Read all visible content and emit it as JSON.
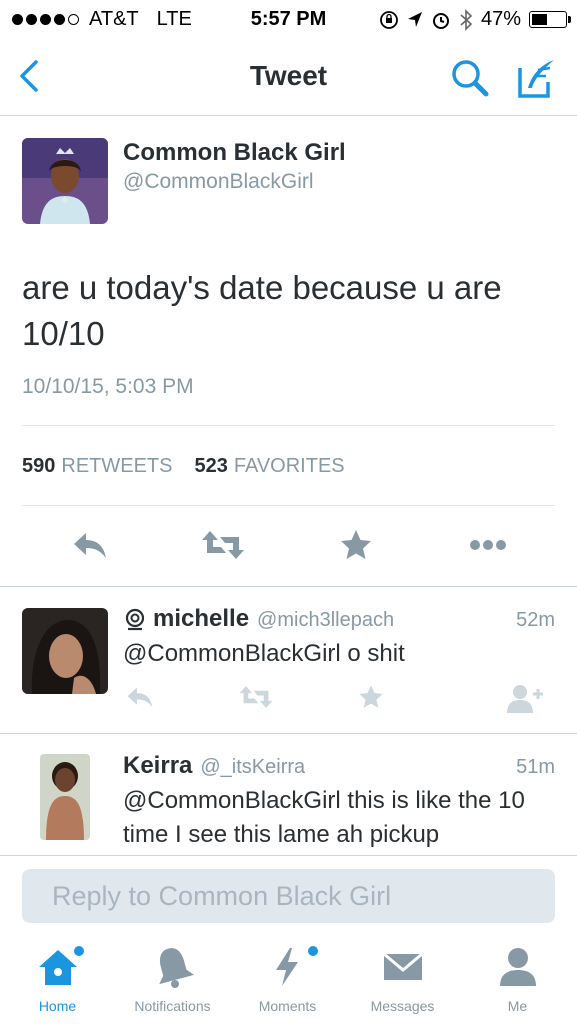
{
  "status_bar": {
    "carrier": "AT&T",
    "network": "LTE",
    "time": "5:57 PM",
    "battery": "47%",
    "battery_level": 0.47
  },
  "nav": {
    "title": "Tweet",
    "back_icon": "chevron-left-icon",
    "search_icon": "search-icon",
    "compose_icon": "compose-icon"
  },
  "tweet": {
    "author_name": "Common Black Girl",
    "author_handle": "@CommonBlackGirl",
    "text": "are u today's date because u are 10/10",
    "timestamp": "10/10/15, 5:03 PM",
    "retweets_count": "590",
    "retweets_label": "RETWEETS",
    "favorites_count": "523",
    "favorites_label": "FAVORITES"
  },
  "replies": [
    {
      "name": "michelle",
      "handle": "@mich3llepach",
      "ago": "52m",
      "text": "@CommonBlackGirl o shit"
    },
    {
      "name": "Keirra",
      "handle": "@_itsKeirra",
      "ago": "51m",
      "text": "@CommonBlackGirl this is like the 10 time I see this lame ah pickup"
    }
  ],
  "reply_bar": {
    "placeholder": "Reply to Common Black Girl"
  },
  "tabs": [
    {
      "label": "Home",
      "icon": "home-icon",
      "active": true
    },
    {
      "label": "Notifications",
      "icon": "bell-icon",
      "active": false
    },
    {
      "label": "Moments",
      "icon": "lightning-icon",
      "active": false
    },
    {
      "label": "Messages",
      "icon": "envelope-icon",
      "active": false
    },
    {
      "label": "Me",
      "icon": "person-icon",
      "active": false
    }
  ],
  "colors": {
    "accent": "#1b95e0",
    "icon_gray": "#8899a6",
    "text": "#292f33"
  }
}
